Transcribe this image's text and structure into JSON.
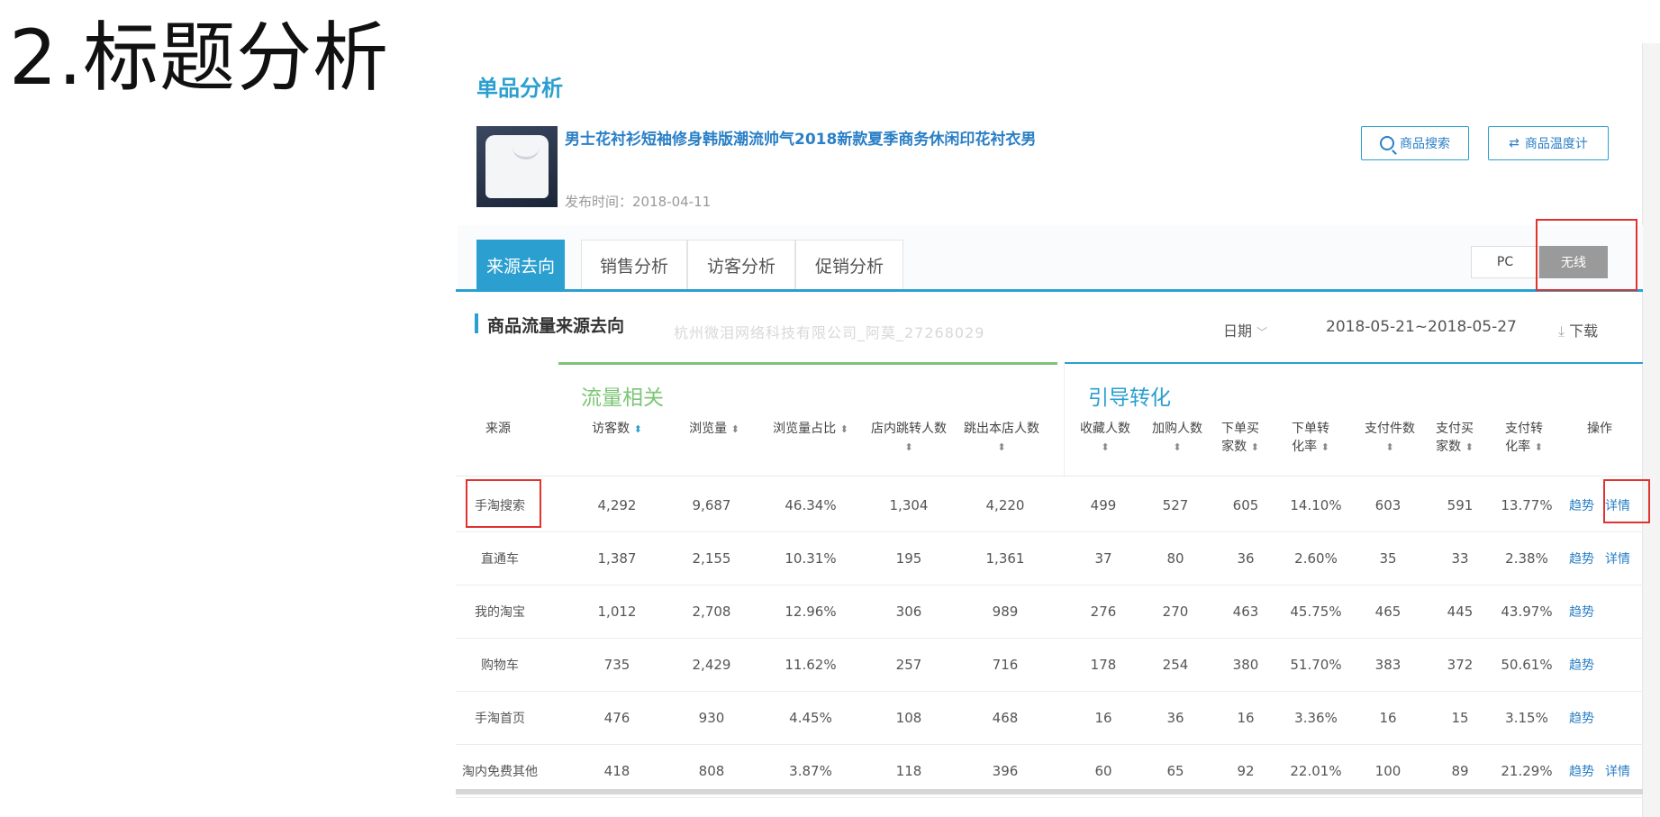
{
  "slide_title": "2.标题分析",
  "section_title": "单品分析",
  "product": {
    "title": "男士花衬衫短袖修身韩版潮流帅气2018新款夏季商务休闲印花衬衣男",
    "publish_date": "发布时间：2018-04-11"
  },
  "buttons": {
    "search": "商品搜索",
    "temperature": "商品温度计"
  },
  "tabs": [
    "来源去向",
    "销售分析",
    "访客分析",
    "促销分析"
  ],
  "device": {
    "pc": "PC",
    "wireless": "无线"
  },
  "subhead": "商品流量来源去向",
  "watermark": "杭州微泪网络科技有限公司_阿莫_27268029",
  "date_label": "日期",
  "date_range": "2018-05-21~2018-05-27",
  "download": "下载",
  "groups": {
    "traffic": "流量相关",
    "conversion": "引导转化"
  },
  "columns": {
    "source": "来源",
    "visitors": "访客数",
    "pageviews": "浏览量",
    "pv_share": "浏览量占比",
    "store_jump": "店内跳转人数",
    "exit_store": "跳出本店人数",
    "favorites": "收藏人数",
    "cart_adds": "加购人数",
    "order_buyers": "下单买家数",
    "order_rate": "下单转化率",
    "pay_items": "支付件数",
    "pay_buyers": "支付买家数",
    "pay_rate": "支付转化率",
    "action": "操作"
  },
  "actions": {
    "trend": "趋势",
    "detail": "详情"
  },
  "rows": [
    {
      "source": "手淘搜索",
      "visitors": "4,292",
      "pageviews": "9,687",
      "pv_share": "46.34%",
      "store_jump": "1,304",
      "exit_store": "4,220",
      "favorites": "499",
      "cart_adds": "527",
      "order_buyers": "605",
      "order_rate": "14.10%",
      "pay_items": "603",
      "pay_buyers": "591",
      "pay_rate": "13.77%",
      "trend": "趋势",
      "detail": "详情"
    },
    {
      "source": "直通车",
      "visitors": "1,387",
      "pageviews": "2,155",
      "pv_share": "10.31%",
      "store_jump": "195",
      "exit_store": "1,361",
      "favorites": "37",
      "cart_adds": "80",
      "order_buyers": "36",
      "order_rate": "2.60%",
      "pay_items": "35",
      "pay_buyers": "33",
      "pay_rate": "2.38%",
      "trend": "趋势",
      "detail": "详情"
    },
    {
      "source": "我的淘宝",
      "visitors": "1,012",
      "pageviews": "2,708",
      "pv_share": "12.96%",
      "store_jump": "306",
      "exit_store": "989",
      "favorites": "276",
      "cart_adds": "270",
      "order_buyers": "463",
      "order_rate": "45.75%",
      "pay_items": "465",
      "pay_buyers": "445",
      "pay_rate": "43.97%",
      "trend": "趋势",
      "detail": ""
    },
    {
      "source": "购物车",
      "visitors": "735",
      "pageviews": "2,429",
      "pv_share": "11.62%",
      "store_jump": "257",
      "exit_store": "716",
      "favorites": "178",
      "cart_adds": "254",
      "order_buyers": "380",
      "order_rate": "51.70%",
      "pay_items": "383",
      "pay_buyers": "372",
      "pay_rate": "50.61%",
      "trend": "趋势",
      "detail": ""
    },
    {
      "source": "手淘首页",
      "visitors": "476",
      "pageviews": "930",
      "pv_share": "4.45%",
      "store_jump": "108",
      "exit_store": "468",
      "favorites": "16",
      "cart_adds": "36",
      "order_buyers": "16",
      "order_rate": "3.36%",
      "pay_items": "16",
      "pay_buyers": "15",
      "pay_rate": "3.15%",
      "trend": "趋势",
      "detail": ""
    },
    {
      "source": "淘内免费其他",
      "visitors": "418",
      "pageviews": "808",
      "pv_share": "3.87%",
      "store_jump": "118",
      "exit_store": "396",
      "favorites": "60",
      "cart_adds": "65",
      "order_buyers": "92",
      "order_rate": "22.01%",
      "pay_items": "100",
      "pay_buyers": "89",
      "pay_rate": "21.29%",
      "trend": "趋势",
      "detail": "详情"
    }
  ]
}
